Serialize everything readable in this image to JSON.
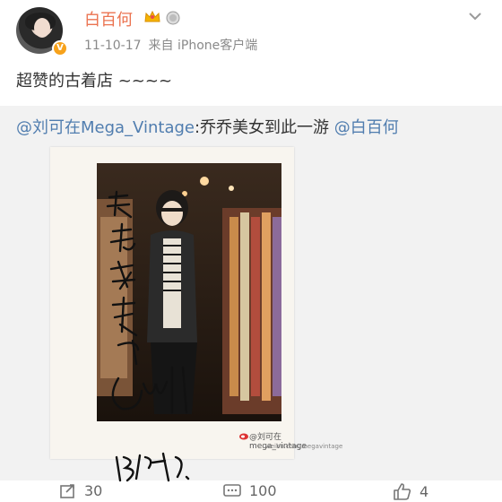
{
  "header": {
    "username": "白百何",
    "timestamp": "11-10-17",
    "source": "来自 iPhone客户端",
    "verified_badge": "V",
    "icons": [
      "crown-icon",
      "medal-icon",
      "chevron-down-icon"
    ]
  },
  "post": {
    "text": "超赞的古着店 ~~~~"
  },
  "retweet": {
    "author_mention": "@刘可在Mega_Vintage",
    "text": ":乔乔美女到此一游 ",
    "tagged_mention": "@白百何",
    "photo": {
      "watermark_handle": "@刘可在mega_vintage",
      "watermark_url": "weibo.com/megavintage"
    }
  },
  "footer": {
    "repost_count": "30",
    "comment_count": "100",
    "like_count": "4"
  },
  "colors": {
    "username": "#eb7350",
    "link": "#507daf",
    "retweet_bg": "#f2f2f2"
  }
}
